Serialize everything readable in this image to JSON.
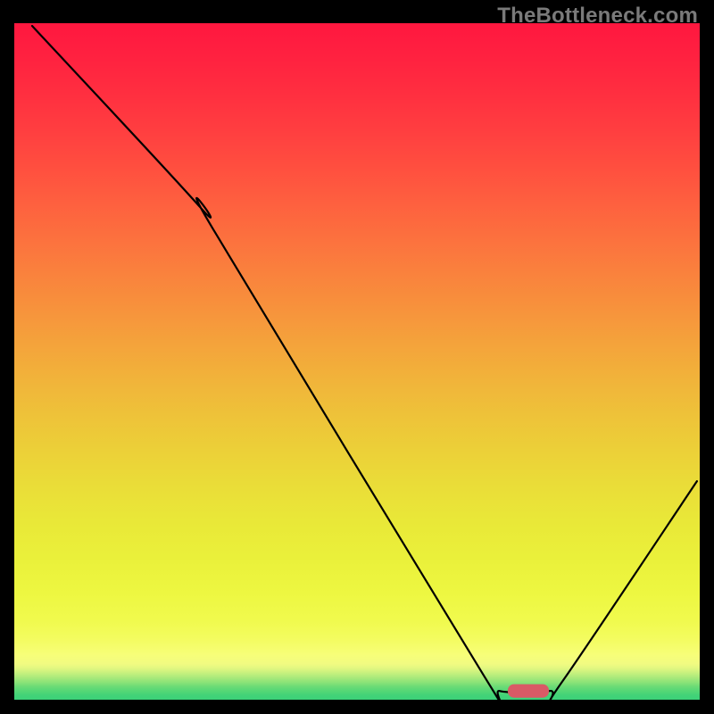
{
  "watermark": "TheBottleneck.com",
  "chart_data": {
    "type": "line",
    "title": "",
    "xlabel": "",
    "ylabel": "",
    "xlim": [
      0,
      100
    ],
    "ylim": [
      0,
      100
    ],
    "grid": false,
    "legend": false,
    "curve_points": [
      {
        "x": 2.6,
        "y": 99.6
      },
      {
        "x": 27.3,
        "y": 72.6
      },
      {
        "x": 29.4,
        "y": 68.9
      },
      {
        "x": 68.6,
        "y": 3.4
      },
      {
        "x": 70.8,
        "y": 1.3
      },
      {
        "x": 78.1,
        "y": 1.3
      },
      {
        "x": 80.1,
        "y": 2.9
      },
      {
        "x": 99.6,
        "y": 32.3
      }
    ],
    "marker": {
      "x_center": 75.0,
      "y_center": 1.3,
      "width": 6.0,
      "height": 2.0,
      "color": "#d95a66"
    },
    "gradient_stops": [
      {
        "offset": 0.0,
        "color": "#ff173f"
      },
      {
        "offset": 0.053,
        "color": "#ff2240"
      },
      {
        "offset": 0.105,
        "color": "#ff2f40"
      },
      {
        "offset": 0.158,
        "color": "#ff3e40"
      },
      {
        "offset": 0.211,
        "color": "#ff4e3f"
      },
      {
        "offset": 0.263,
        "color": "#fe5f3f"
      },
      {
        "offset": 0.316,
        "color": "#fc703e"
      },
      {
        "offset": 0.368,
        "color": "#fa813d"
      },
      {
        "offset": 0.421,
        "color": "#f7923c"
      },
      {
        "offset": 0.474,
        "color": "#f4a33b"
      },
      {
        "offset": 0.526,
        "color": "#f1b33a"
      },
      {
        "offset": 0.579,
        "color": "#eec239"
      },
      {
        "offset": 0.632,
        "color": "#ecd038"
      },
      {
        "offset": 0.684,
        "color": "#eadd38"
      },
      {
        "offset": 0.737,
        "color": "#e9e838"
      },
      {
        "offset": 0.789,
        "color": "#eaf03a"
      },
      {
        "offset": 0.842,
        "color": "#edf741"
      },
      {
        "offset": 0.882,
        "color": "#f0fa4d"
      },
      {
        "offset": 0.908,
        "color": "#f3fc5e"
      },
      {
        "offset": 0.921,
        "color": "#f5fd6b"
      },
      {
        "offset": 0.934,
        "color": "#f7fe79"
      },
      {
        "offset": 0.947,
        "color": "#f1fb81"
      },
      {
        "offset": 0.954,
        "color": "#e0f781"
      },
      {
        "offset": 0.96,
        "color": "#c8f17e"
      },
      {
        "offset": 0.967,
        "color": "#abea7b"
      },
      {
        "offset": 0.974,
        "color": "#8ce378"
      },
      {
        "offset": 0.98,
        "color": "#6edc76"
      },
      {
        "offset": 0.987,
        "color": "#55d776"
      },
      {
        "offset": 0.993,
        "color": "#43d377"
      },
      {
        "offset": 1.0,
        "color": "#3cd179"
      }
    ]
  }
}
